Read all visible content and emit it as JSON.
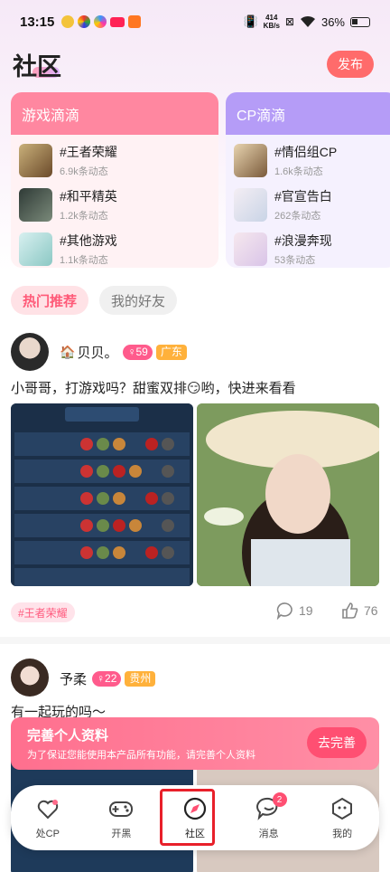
{
  "status_bar": {
    "time": "13:15",
    "net_speed": "414",
    "net_unit": "KB/s",
    "battery": "36%"
  },
  "header": {
    "title": "社区",
    "publish_label": "发布"
  },
  "game_card": {
    "title": "游戏滴滴",
    "items": [
      {
        "name": "#王者荣耀",
        "count": "6.9k条动态"
      },
      {
        "name": "#和平精英",
        "count": "1.2k条动态"
      },
      {
        "name": "#其他游戏",
        "count": "1.1k条动态"
      }
    ]
  },
  "cp_card": {
    "title": "CP滴滴",
    "items": [
      {
        "name": "#情侣组CP",
        "count": "1.6k条动态"
      },
      {
        "name": "#官宣告白",
        "count": "262条动态"
      },
      {
        "name": "#浪漫奔现",
        "count": "53条动态"
      }
    ]
  },
  "tabs": [
    {
      "label": "热门推荐"
    },
    {
      "label": "我的好友"
    }
  ],
  "posts": [
    {
      "username": "贝贝。",
      "level": "59",
      "city": "广东",
      "text": "小哥哥，打游戏吗？甜蜜双排😏哟，快进来看看",
      "tag": "#王者荣耀",
      "comments": "19",
      "likes": "76"
    },
    {
      "username": "予柔",
      "level": "22",
      "city": "贵州",
      "text": "有一起玩的吗～"
    }
  ],
  "banner": {
    "title": "完善个人资料",
    "subtitle": "为了保证您能使用本产品所有功能，请完善个人资料",
    "button": "去完善"
  },
  "nav": [
    {
      "label": "处CP",
      "icon": "heart-chat-icon"
    },
    {
      "label": "开黑",
      "icon": "gamepad-icon"
    },
    {
      "label": "社区",
      "icon": "compass-icon"
    },
    {
      "label": "消息",
      "icon": "message-icon",
      "badge": "2"
    },
    {
      "label": "我的",
      "icon": "profile-icon"
    }
  ],
  "colors": {
    "accent": "#ff6b6b",
    "game_card": "#ff87a0",
    "cp_card": "#b59cf7",
    "highlight": "#e8202a"
  }
}
